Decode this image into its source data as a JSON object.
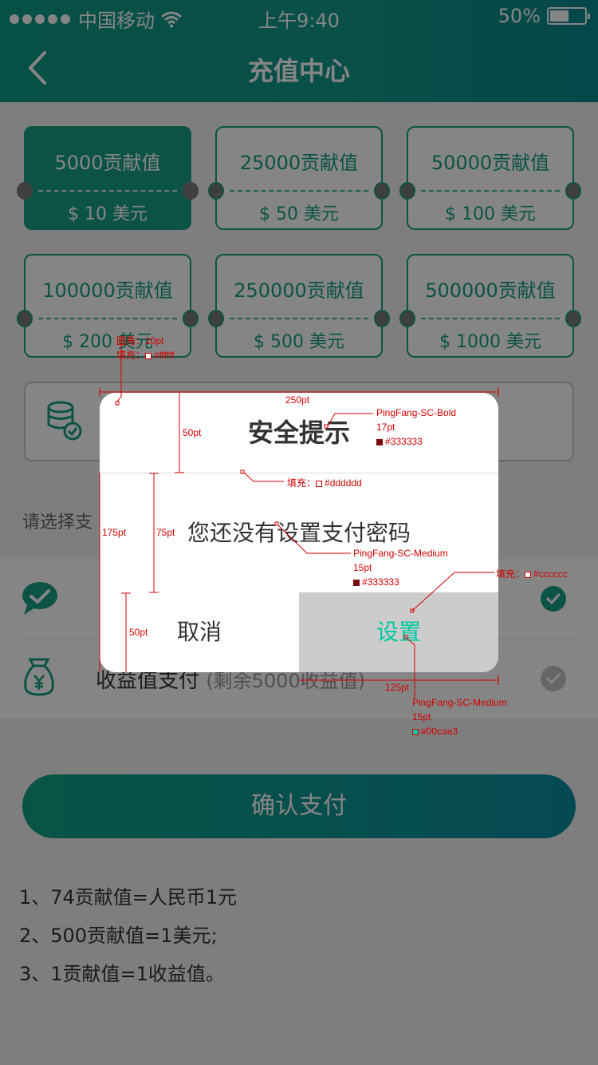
{
  "status_bar": {
    "carrier": "中国移动",
    "time": "上午9:40",
    "battery": "50%"
  },
  "nav": {
    "title": "充值中心"
  },
  "packages": [
    {
      "amount": "5000贡献值",
      "price": "$ 10 美元"
    },
    {
      "amount": "25000贡献值",
      "price": "$ 50 美元"
    },
    {
      "amount": "50000贡献值",
      "price": "$ 100 美元"
    },
    {
      "amount": "100000贡献值",
      "price": "$ 200 美元"
    },
    {
      "amount": "250000贡献值",
      "price": "$ 500 美元"
    },
    {
      "amount": "500000贡献值",
      "price": "$ 1000 美元"
    }
  ],
  "section_label": "请选择支",
  "payment": {
    "income_label": "收益值支付",
    "income_sub": "(剩余5000收益值)"
  },
  "confirm_label": "确认支付",
  "notes": [
    "1、74贡献值=人民币1元",
    "2、500贡献值=1美元;",
    "3、1贡献值=1收益值。"
  ],
  "dialog": {
    "title": "安全提示",
    "message": "您还没有设置支付密码",
    "cancel_label": "取消",
    "set_label": "设置"
  },
  "annotations": {
    "corner_radius": "圆角：10pt",
    "fill_white": "填充：",
    "fill_white_hex": "#ffffff",
    "width_250": "250pt",
    "title_font": "PingFang-SC-Bold",
    "title_size": "17pt",
    "title_color": "#333333",
    "height_50_top": "50pt",
    "divider_fill": "填充：",
    "divider_hex": "#dddddd",
    "height_175": "175pt",
    "height_75": "75pt",
    "msg_font": "PingFang-SC-Medium",
    "msg_size": "15pt",
    "msg_color": "#333333",
    "btn_fill": "填充：",
    "btn_fill_hex": "#cccccc",
    "height_50_bottom": "50pt",
    "width_125": "125pt",
    "btn_font": "PingFang-SC-Medium",
    "btn_size": "15pt",
    "btn_color": "#00caa3"
  },
  "colors": {
    "primary": "#18a084",
    "accent": "#00caa3",
    "divider": "#dddddd",
    "button_bg": "#cccccc",
    "text": "#333333"
  }
}
